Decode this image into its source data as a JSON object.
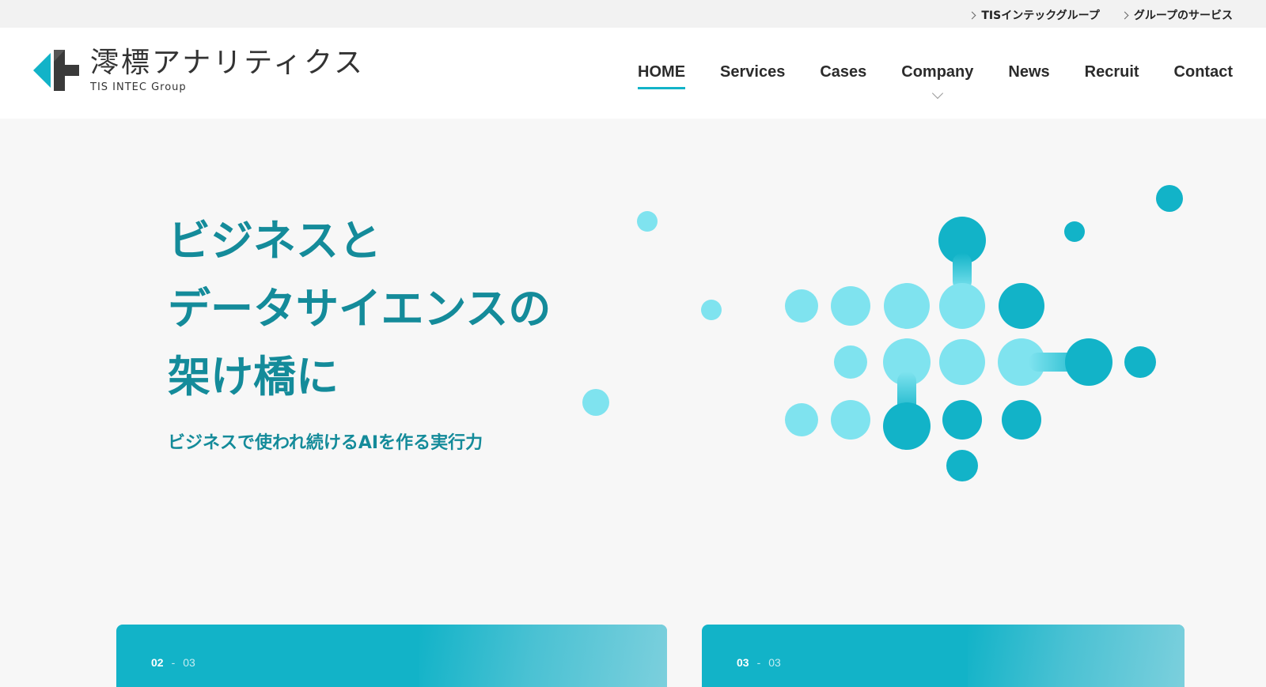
{
  "top_links": [
    {
      "label": "TISインテックグループ"
    },
    {
      "label": "グループのサービス"
    }
  ],
  "logo": {
    "name_jp": "澪標アナリティクス",
    "group": "TIS INTEC Group"
  },
  "nav": [
    {
      "label": "HOME",
      "active": true
    },
    {
      "label": "Services"
    },
    {
      "label": "Cases"
    },
    {
      "label": "Company",
      "has_dropdown": true
    },
    {
      "label": "News"
    },
    {
      "label": "Recruit"
    },
    {
      "label": "Contact"
    }
  ],
  "hero": {
    "title_lines": [
      "ビジネスと",
      "データサイエンスの",
      "架け橋に"
    ],
    "subtitle": "ビジネスで使われ続けるAIを作る実行力"
  },
  "cards": [
    {
      "index": "02",
      "sep": "-",
      "total": "03"
    },
    {
      "index": "03",
      "sep": "-",
      "total": "03"
    }
  ],
  "colors": {
    "accent": "#12b3c8",
    "accent_dark": "#148b9a",
    "light_cyan": "#7fe3ef",
    "mid_cyan": "#5fd6e6"
  }
}
